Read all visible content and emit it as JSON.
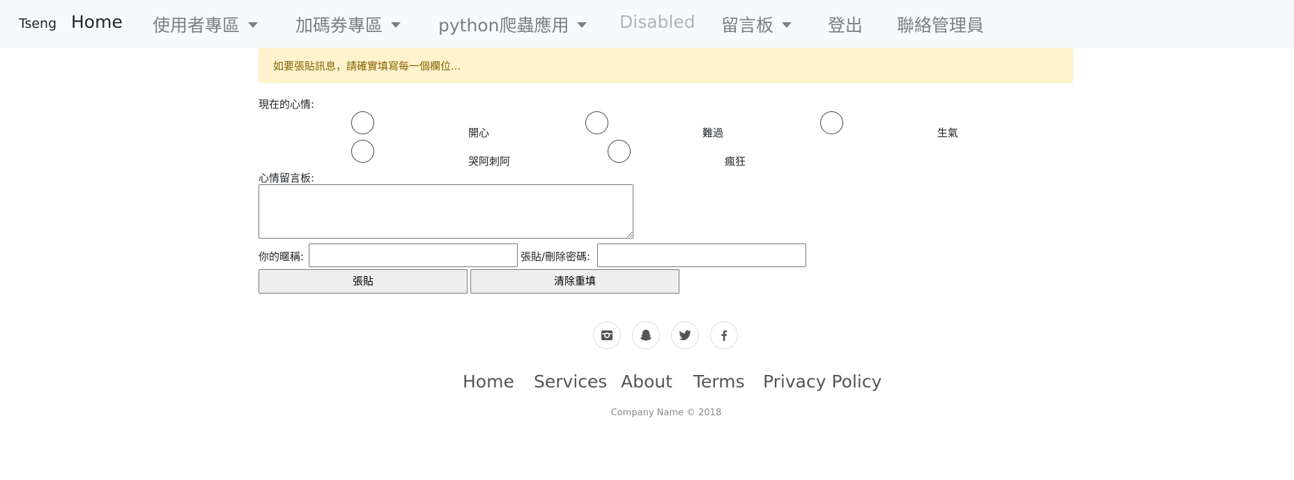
{
  "navbar": {
    "brand": "Tseng",
    "items": [
      {
        "label": "Home"
      },
      {
        "label": "使用者專區"
      },
      {
        "label": "加碼券專區"
      },
      {
        "label": "python爬蟲應用"
      },
      {
        "label": "Disabled"
      },
      {
        "label": "留言板"
      },
      {
        "label": "登出"
      },
      {
        "label": "聯絡管理員"
      }
    ]
  },
  "alert": {
    "text": "如要張貼訊息，請確實填寫每一個欄位..."
  },
  "form": {
    "mood_label": "現在的心情:",
    "moods": [
      {
        "label": "開心"
      },
      {
        "label": "難過"
      },
      {
        "label": "生氣"
      },
      {
        "label": "哭阿刺阿"
      },
      {
        "label": "瘋狂"
      }
    ],
    "message_label": "心情留言板:",
    "message_value": "",
    "nickname_label": "你的暱稱:",
    "nickname_value": "",
    "password_label": "張貼/刪除密碼:",
    "password_value": "",
    "submit_label": "張貼",
    "reset_label": "清除重填"
  },
  "social": [
    {
      "icon": "instagram-icon"
    },
    {
      "icon": "snapchat-icon"
    },
    {
      "icon": "twitter-icon"
    },
    {
      "icon": "facebook-icon"
    }
  ],
  "footer": {
    "links": [
      {
        "label": "Home"
      },
      {
        "label": "Services"
      },
      {
        "label": "About"
      },
      {
        "label": "Terms"
      },
      {
        "label": "Privacy Policy"
      }
    ],
    "copyright": "Company Name © 2018"
  }
}
